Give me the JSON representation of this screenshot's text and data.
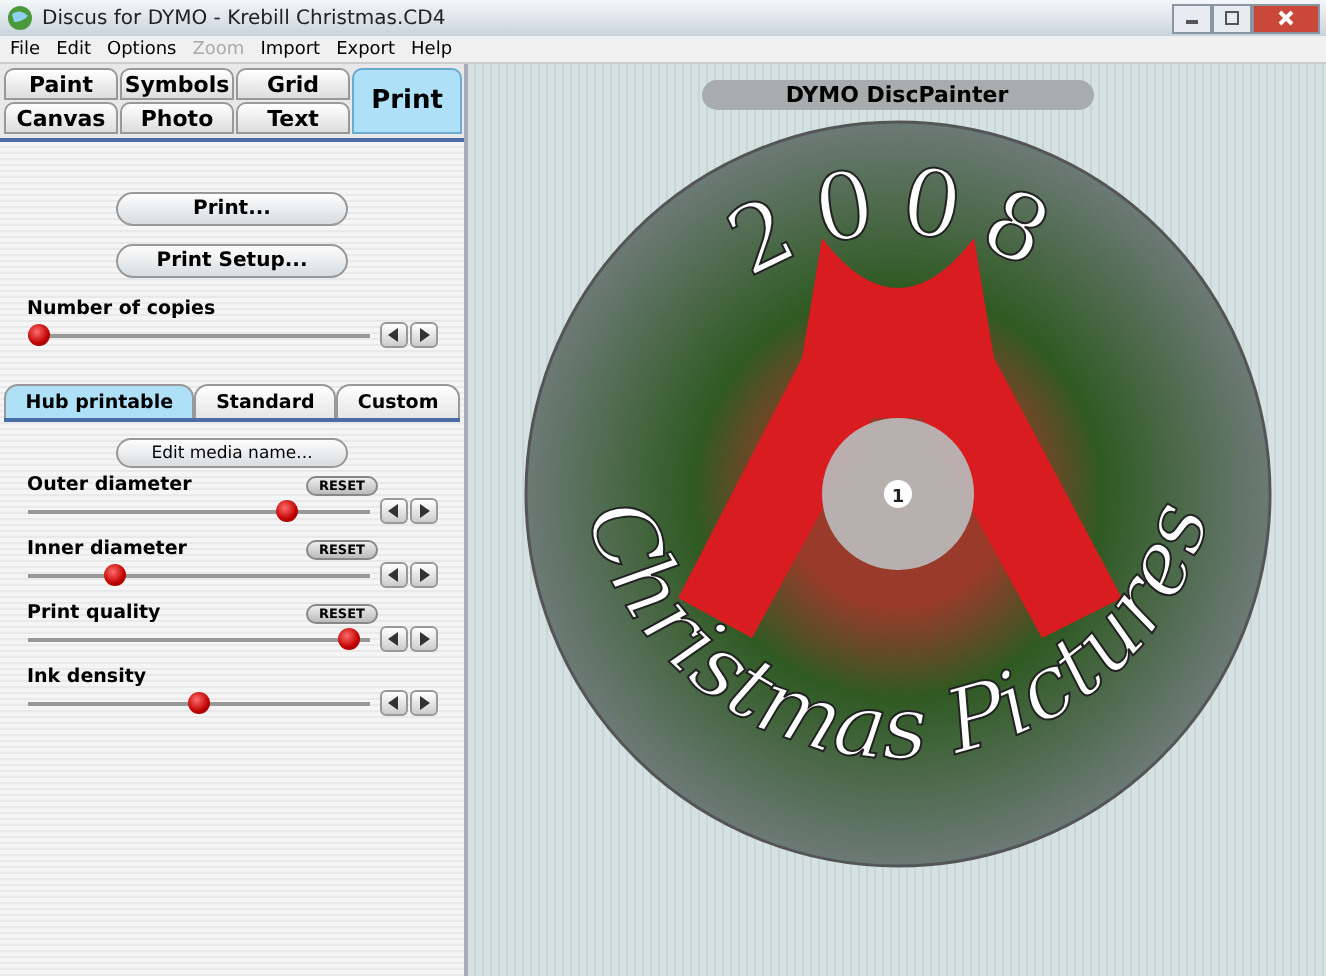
{
  "window": {
    "title": "Discus for DYMO - Krebill Christmas.CD4"
  },
  "menu": [
    {
      "label": "File",
      "disabled": false
    },
    {
      "label": "Edit",
      "disabled": false
    },
    {
      "label": "Options",
      "disabled": false
    },
    {
      "label": "Zoom",
      "disabled": true
    },
    {
      "label": "Import",
      "disabled": false
    },
    {
      "label": "Export",
      "disabled": false
    },
    {
      "label": "Help",
      "disabled": false
    }
  ],
  "mode_tabs": [
    {
      "label": "Paint",
      "kind": "small",
      "selected": false
    },
    {
      "label": "Symbols",
      "kind": "small",
      "selected": false
    },
    {
      "label": "Grid",
      "kind": "small",
      "selected": false
    },
    {
      "label": "Print",
      "kind": "wide",
      "selected": true
    },
    {
      "label": "Canvas",
      "kind": "small",
      "selected": false
    },
    {
      "label": "Photo",
      "kind": "small",
      "selected": false
    },
    {
      "label": "Text",
      "kind": "small",
      "selected": false
    }
  ],
  "print_buttons": [
    "Print...",
    "Print Setup..."
  ],
  "copies": {
    "label": "Number of copies",
    "level": 0.0
  },
  "media_tabs": [
    {
      "label": "Hub printable",
      "selected": true
    },
    {
      "label": "Standard",
      "selected": false
    },
    {
      "label": "Custom",
      "selected": false
    }
  ],
  "edit_media_button": "Edit media name...",
  "sliders": [
    {
      "label": "Outer diameter",
      "reset": "RESET",
      "level": 0.78
    },
    {
      "label": "Inner diameter",
      "reset": "RESET",
      "level": 0.24
    },
    {
      "label": "Print quality",
      "reset": "RESET",
      "level": 0.97
    },
    {
      "label": "Ink density",
      "level": 0.5
    }
  ],
  "canvas": {
    "title": "DYMO DiscPainter",
    "top_text": "2008",
    "bottom_text": "Christmas Pictures",
    "hub_badge": "1"
  }
}
